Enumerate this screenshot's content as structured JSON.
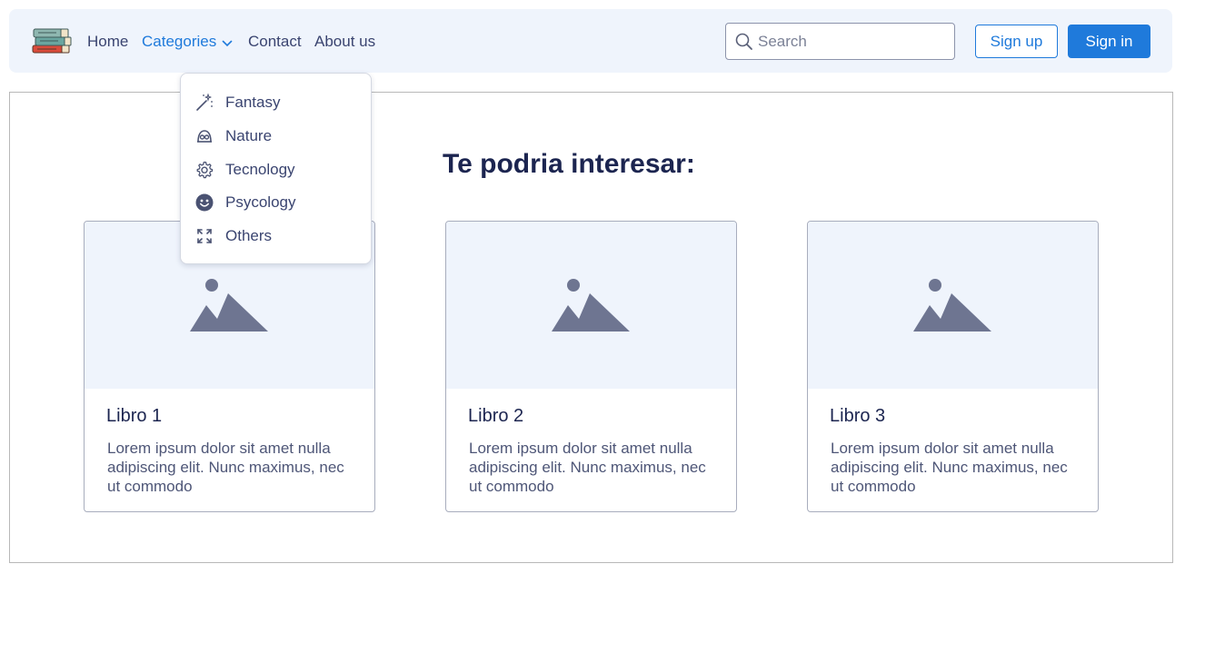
{
  "nav": {
    "links": [
      {
        "label": "Home"
      },
      {
        "label": "Categories"
      },
      {
        "label": "Contact"
      },
      {
        "label": "About us"
      }
    ],
    "search_placeholder": "Search",
    "signup_label": "Sign up",
    "signin_label": "Sign in",
    "accent_color": "#1f7adb"
  },
  "categories_menu": {
    "items": [
      {
        "label": "Fantasy",
        "icon": "magic-wand-icon"
      },
      {
        "label": "Nature",
        "icon": "nature-icon"
      },
      {
        "label": "Tecnology",
        "icon": "gear-icon"
      },
      {
        "label": "Psycology",
        "icon": "smiley-icon"
      },
      {
        "label": "Others",
        "icon": "expand-icon"
      }
    ]
  },
  "main": {
    "title": "Te podria interesar:",
    "cards": [
      {
        "title": "Libro 1",
        "text": "Lorem ipsum dolor sit amet nulla adipiscing elit. Nunc maximus, nec ut commodo",
        "image_icon": "image-placeholder-icon"
      },
      {
        "title": "Libro 2",
        "text": "Lorem ipsum dolor sit amet nulla adipiscing elit. Nunc maximus, nec ut commodo",
        "image_icon": "image-placeholder-icon"
      },
      {
        "title": "Libro 3",
        "text": "Lorem ipsum dolor sit amet nulla adipiscing elit. Nunc maximus, nec ut commodo",
        "image_icon": "image-placeholder-icon"
      }
    ]
  }
}
